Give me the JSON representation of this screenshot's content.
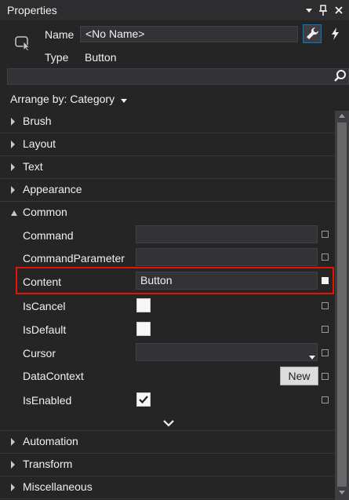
{
  "window": {
    "title": "Properties"
  },
  "header": {
    "name_label": "Name",
    "name_value": "<No Name>",
    "type_label": "Type",
    "type_value": "Button"
  },
  "search": {
    "placeholder": ""
  },
  "arrange": {
    "label": "Arrange by: Category"
  },
  "categories": {
    "brush": "Brush",
    "layout": "Layout",
    "text": "Text",
    "appearance": "Appearance",
    "common": "Common",
    "automation": "Automation",
    "transform": "Transform",
    "miscellaneous": "Miscellaneous"
  },
  "common_props": {
    "command": {
      "label": "Command",
      "value": ""
    },
    "command_parameter": {
      "label": "CommandParameter",
      "value": ""
    },
    "content": {
      "label": "Content",
      "value": "Button"
    },
    "is_cancel": {
      "label": "IsCancel",
      "checked": false
    },
    "is_default": {
      "label": "IsDefault",
      "checked": false
    },
    "cursor": {
      "label": "Cursor",
      "value": ""
    },
    "data_context": {
      "label": "DataContext",
      "button": "New"
    },
    "is_enabled": {
      "label": "IsEnabled",
      "checked": true
    }
  },
  "icons": [
    "dropdown-icon",
    "pin-icon",
    "close-icon",
    "pointer-icon",
    "wrench-icon",
    "lightning-icon",
    "search-icon",
    "chevron-down-icon"
  ],
  "colors": {
    "background": "#252526",
    "highlight": "#e51400",
    "accent": "#007acc"
  }
}
